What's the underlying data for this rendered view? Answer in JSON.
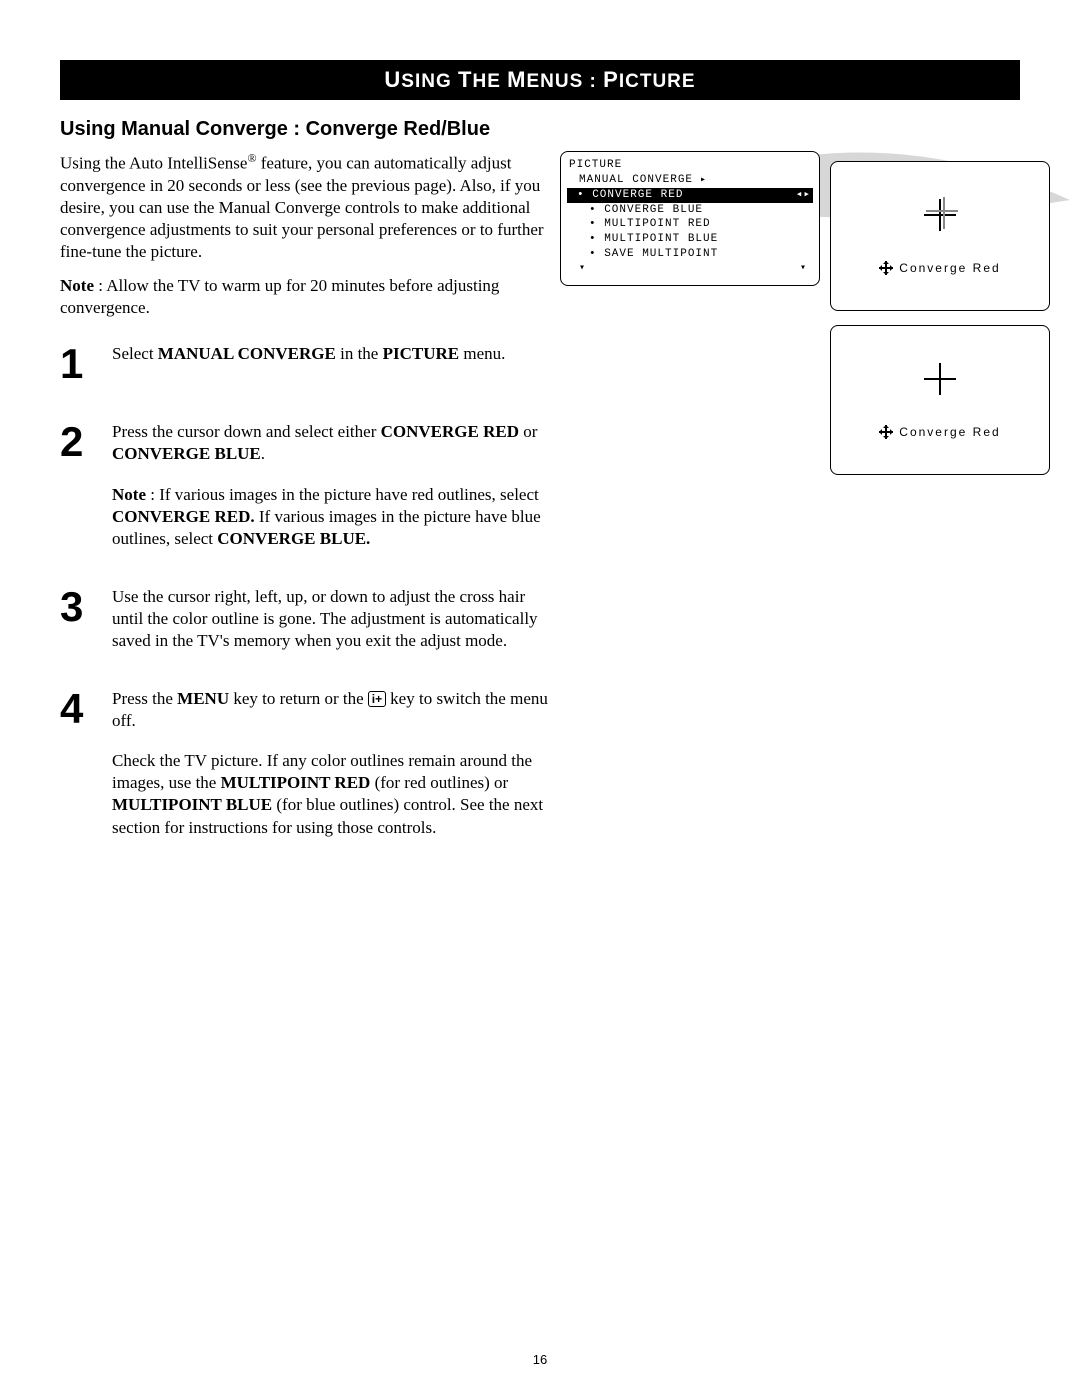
{
  "header": {
    "title_html": "USING THE MENUS : PICTURE"
  },
  "section_title": "Using Manual Converge : Converge Red/Blue",
  "intro": {
    "p1_pre": "Using the Auto IntelliSense",
    "p1_post": " feature, you can automatically adjust convergence in 20 seconds or less (see the previous page). Also, if you desire, you can use the Manual Converge controls to make additional convergence adjustments to suit your personal preferences or to further fine-tune the picture.",
    "note_label": "Note",
    "note_text": " : Allow the TV to warm up for 20 minutes before adjusting convergence."
  },
  "steps": [
    {
      "num": "1",
      "parts": [
        {
          "t": "Select ",
          "b": false
        },
        {
          "t": "MANUAL CONVERGE",
          "b": true
        },
        {
          "t": " in the ",
          "b": false
        },
        {
          "t": "PICTURE",
          "b": true
        },
        {
          "t": " menu.",
          "b": false
        }
      ]
    },
    {
      "num": "2",
      "parts": [
        {
          "t": "Press the cursor down and select either ",
          "b": false
        },
        {
          "t": "CONVERGE RED",
          "b": true
        },
        {
          "t": " or ",
          "b": false
        },
        {
          "t": "CONVERGE BLUE",
          "b": true
        },
        {
          "t": ".",
          "b": false
        }
      ],
      "note": [
        {
          "t": "Note",
          "b": true
        },
        {
          "t": " : If various images in the picture have red outlines, select ",
          "b": false
        },
        {
          "t": "CONVERGE RED.",
          "b": true
        },
        {
          "t": " If various images in the picture have blue outlines, select ",
          "b": false
        },
        {
          "t": "CONVERGE BLUE.",
          "b": true
        }
      ]
    },
    {
      "num": "3",
      "text": "Use the cursor right, left, up, or down to adjust the cross hair until the color outline is gone. The adjustment is automatically saved in the TV's memory when you exit the adjust mode."
    },
    {
      "num": "4",
      "parts": [
        {
          "t": "Press the ",
          "b": false
        },
        {
          "t": "MENU",
          "b": true
        },
        {
          "t": " key to return or the ",
          "b": false
        },
        {
          "icon": "info"
        },
        {
          "t": " key to switch the menu off.",
          "b": false
        }
      ],
      "follow": [
        {
          "t": "Check the TV picture. If any color outlines remain around the images, use the ",
          "b": false
        },
        {
          "t": "MULTIPOINT RED",
          "b": true
        },
        {
          "t": " (for red outlines) or ",
          "b": false
        },
        {
          "t": "MULTIPOINT BLUE",
          "b": true
        },
        {
          "t": " (for blue outlines) control. See the next section for instructions for using those controls.",
          "b": false
        }
      ]
    }
  ],
  "menu": {
    "title": "PICTURE",
    "sub": "MANUAL CONVERGE",
    "selected": "CONVERGE RED",
    "items": [
      "CONVERGE BLUE",
      "MULTIPOINT RED",
      "MULTIPOINT BLUE",
      "SAVE MULTIPOINT"
    ]
  },
  "tv_label": "Converge Red",
  "page_number": "16"
}
